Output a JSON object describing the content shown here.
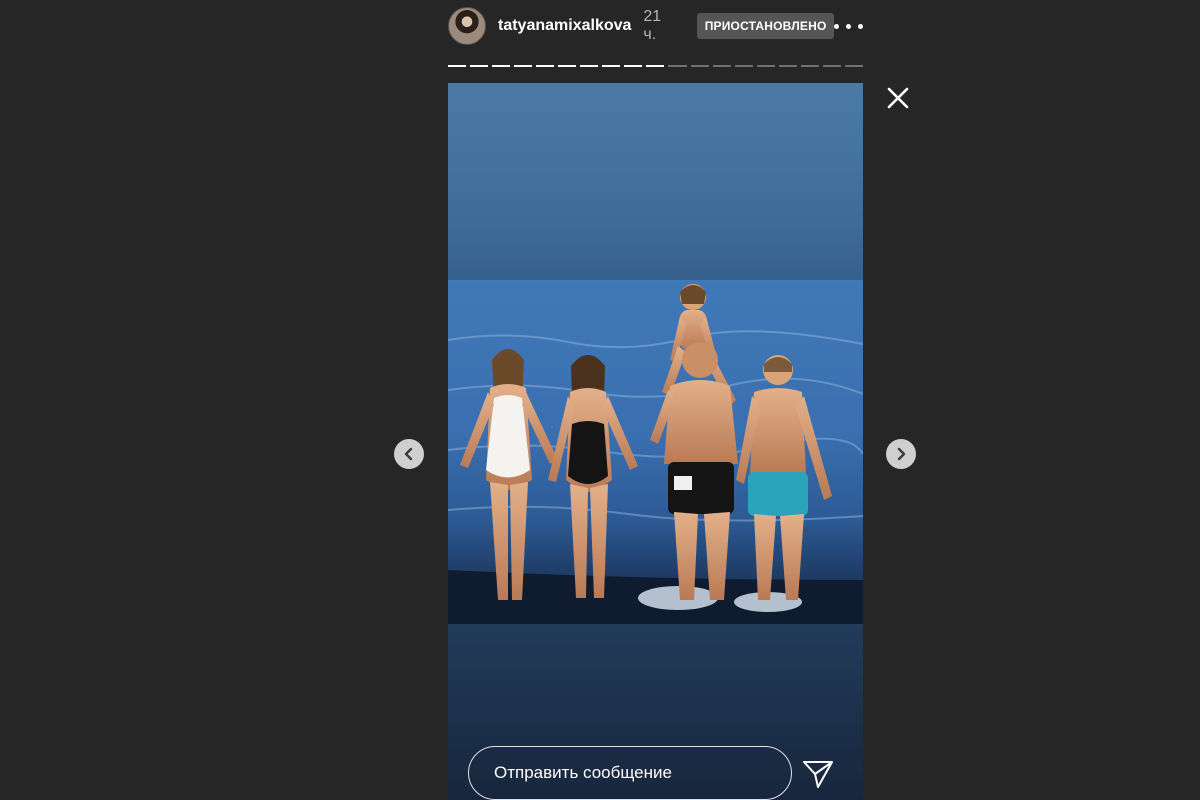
{
  "story": {
    "username": "tatyanamixalkova",
    "time_ago": "21 ч.",
    "status_badge": "ПРИОСТАНОВЛЕНО",
    "progress": {
      "total_segments": 19,
      "viewed_segments": 10
    }
  },
  "reply": {
    "placeholder": "Отправить сообщение"
  },
  "icons": {
    "more": "more-options-icon",
    "close": "close-icon",
    "prev": "chevron-left-icon",
    "next": "chevron-right-icon",
    "send": "send-icon"
  },
  "colors": {
    "background": "#262626",
    "badge": "#555555",
    "nav_button": "#cfcfcf"
  }
}
